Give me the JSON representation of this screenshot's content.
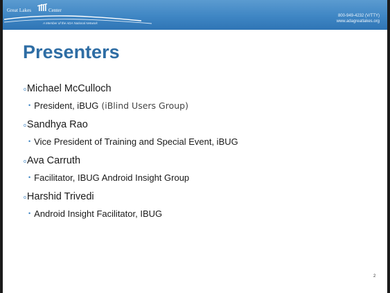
{
  "header": {
    "logo_text_left": "Great Lakes",
    "logo_text_right": "Center",
    "tagline": "A Member of the ADA National Network",
    "phone": "800-949-4232 (V/TTY)",
    "website": "www.adagreatlakes.org"
  },
  "slide": {
    "title": "Presenters",
    "page_number": "2"
  },
  "presenters": [
    {
      "name": "Michael McCulloch",
      "role": "President, iBUG",
      "role_extra": "(iBlind Users Group)"
    },
    {
      "name": "Sandhya Rao",
      "role": "Vice President of Training and Special Event, iBUG",
      "role_extra": ""
    },
    {
      "name": "Ava Carruth",
      "role": "Facilitator, IBUG Android Insight Group",
      "role_extra": ""
    },
    {
      "name": "Harshid Trivedi",
      "role": "Android Insight Facilitator, IBUG",
      "role_extra": ""
    }
  ],
  "colors": {
    "banner": "#3f86c4",
    "title": "#2e6da4",
    "bullet": "#3d84c2"
  },
  "icons": {
    "level1_marker": "o",
    "level2_marker": "•"
  }
}
